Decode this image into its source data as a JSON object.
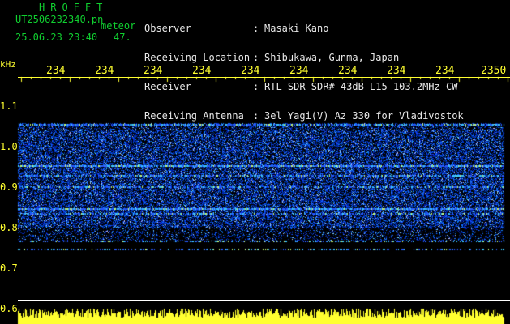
{
  "header": {
    "brand": "HROFFT",
    "file_name": "UT2506232340.pn",
    "meteor_label": "meteor",
    "date_time": "25.06.23 23:40",
    "count": "47."
  },
  "info": {
    "labels": [
      "Observer",
      "Receiving Location",
      "Receiver",
      "Receiving Antenna"
    ],
    "colons": [
      ":",
      ":",
      ":",
      ":"
    ],
    "values": [
      "Masaki Kano",
      "Shibukawa, Gunma, Japan",
      "RTL-SDR SDR# 43dB L15 103.2MHz CW",
      "3el Yagi(V) Az 330 for Vladivostok"
    ]
  },
  "axes": {
    "y_unit": "kHz",
    "x_ticks": [
      "234",
      "234",
      "234",
      "234",
      "234",
      "234",
      "234",
      "234",
      "234",
      "2350"
    ],
    "y_ticks": [
      "1.1",
      "1.0",
      "0.9",
      "0.8",
      "0.7",
      "0.6"
    ]
  },
  "colors": {
    "background": "#000000",
    "brand_text": "#10d030",
    "info_text": "#e8e8e8",
    "axis_text": "#ffff30",
    "signal_band": "#1a3aff"
  }
}
